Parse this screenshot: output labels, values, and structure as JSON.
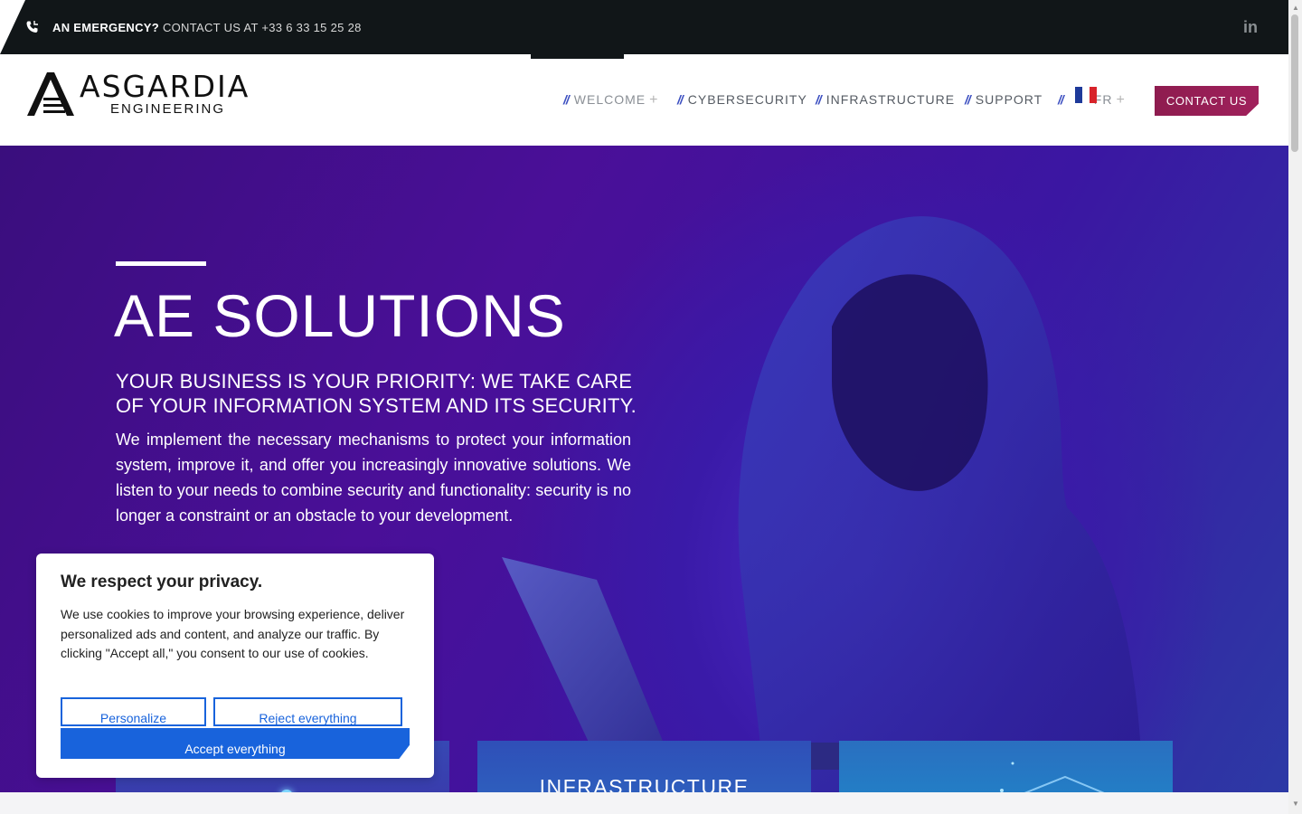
{
  "topbar": {
    "emergency_bold": "AN EMERGENCY?",
    "emergency_text": " CONTACT US AT +33 6 33 15 25 28",
    "linkedin_label": "in"
  },
  "header": {
    "logo_main": "ASGARDIA",
    "logo_sub": "ENGINEERING",
    "nav": {
      "welcome": "WELCOME",
      "cybersecurity": "CYBERSECURITY",
      "infrastructure": "INFRASTRUCTURE",
      "support": "SUPPORT",
      "language": "FR",
      "separator": "//",
      "plus": "+"
    },
    "contact_button": "CONTACT US"
  },
  "hero": {
    "title": "AE SOLUTIONS",
    "subtitle": "YOUR BUSINESS IS YOUR PRIORITY: WE TAKE CARE OF YOUR INFORMATION SYSTEM AND ITS SECURITY.",
    "body": "We implement the necessary mechanisms to protect your information system, improve it, and offer you increasingly innovative solutions. We listen to your needs to combine security and functionality: security is no longer a constraint or an obstacle to your development."
  },
  "cards": {
    "infrastructure": "INFRASTRUCTURE"
  },
  "cookie": {
    "title": "We respect your privacy.",
    "text": "We use cookies to improve your browsing experience, deliver personalized ads and content, and analyze our traffic. By clicking \"Accept all,\" you consent to our use of cookies.",
    "personalize": "Personalize",
    "reject": "Reject everything",
    "accept": "Accept everything"
  },
  "colors": {
    "topbar": "#111618",
    "accent_nav": "#3b4ec0",
    "cta": "#9a1f57",
    "cookie_blue": "#1863dc"
  },
  "icons": [
    "phone-icon",
    "linkedin-icon",
    "fr-flag-icon",
    "plus-icon",
    "hacker-illustration"
  ]
}
